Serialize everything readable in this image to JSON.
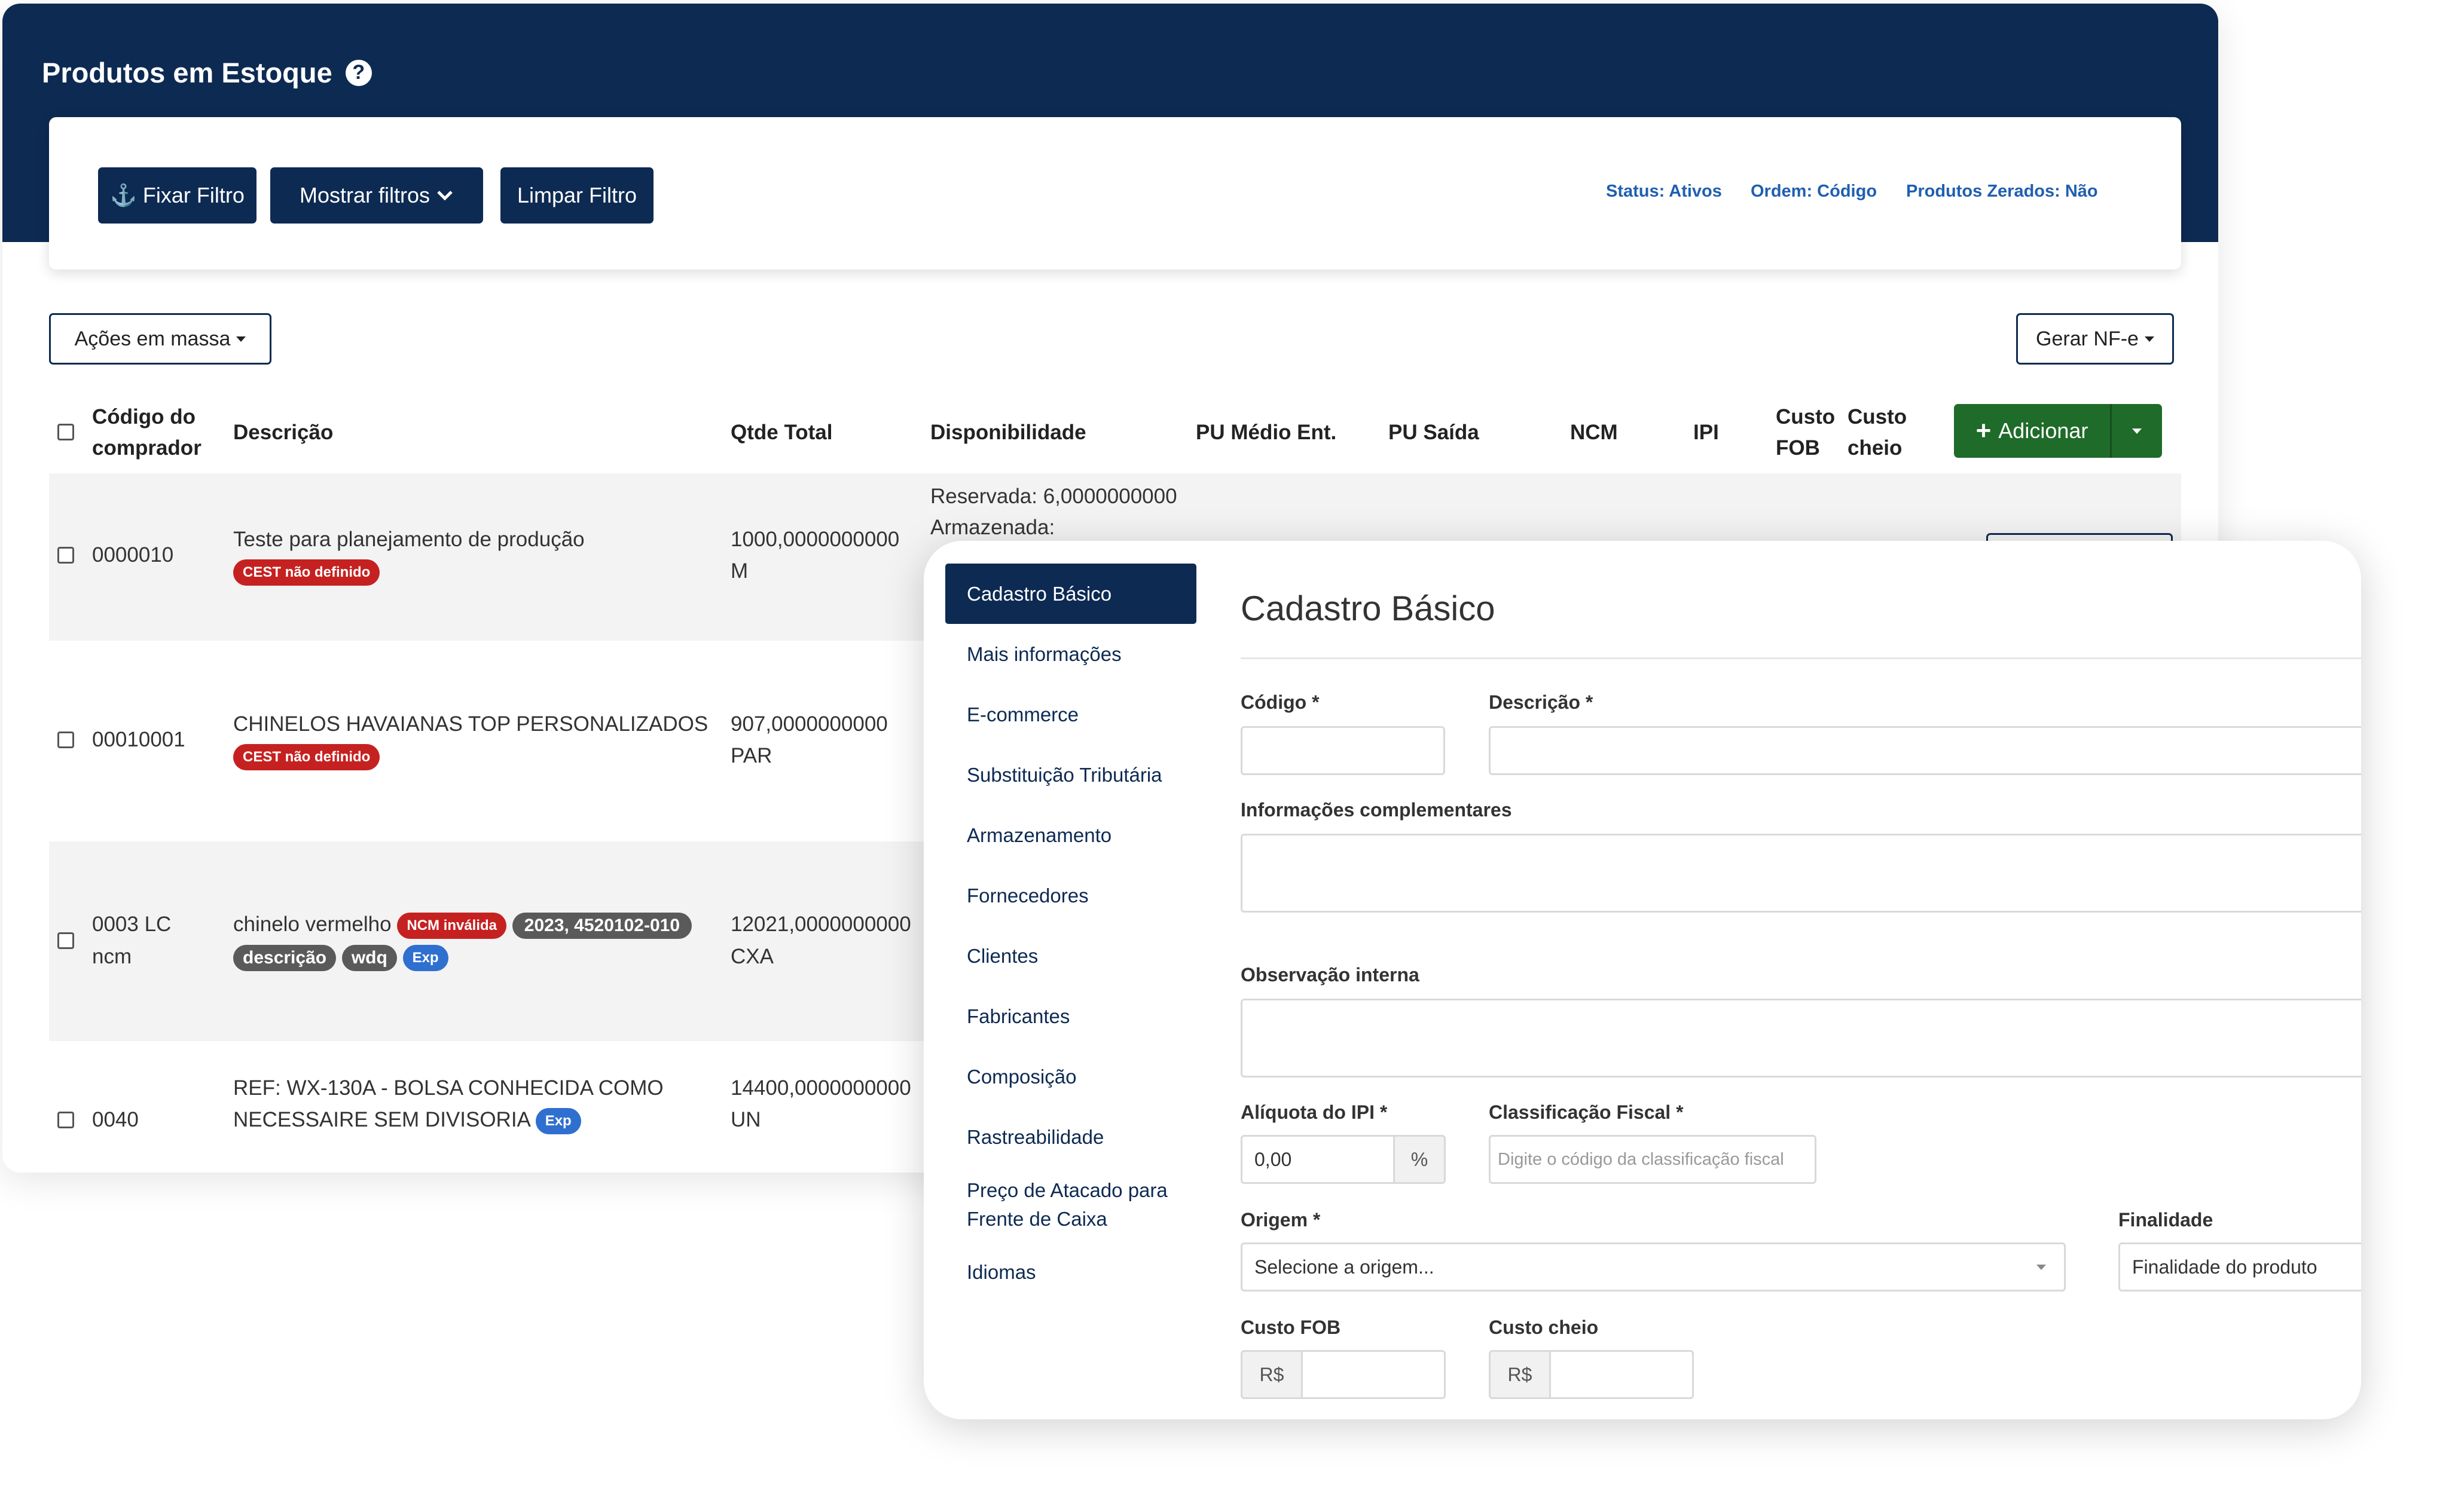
{
  "header": {
    "title": "Produtos em Estoque",
    "help_icon": "question-circle-icon"
  },
  "filters": {
    "fix_filter": "Fixar Filtro",
    "show_filters": "Mostrar filtros",
    "clear_filter": "Limpar Filtro",
    "status": "Status: Ativos",
    "order": "Ordem: Código",
    "zeroed": "Produtos Zerados: Não"
  },
  "toolbar": {
    "bulk_actions": "Ações em massa",
    "generate_nfe": "Gerar NF-e",
    "add": "Adicionar"
  },
  "table": {
    "col_code_1": "Código do",
    "col_code_2": "comprador",
    "col_desc": "Descrição",
    "col_qty": "Qtde Total",
    "col_avail": "Disponibilidade",
    "col_pu_in": "PU Médio Ent.",
    "col_pu_out": "PU Saída",
    "col_ncm": "NCM",
    "col_ipi": "IPI",
    "col_fob_1": "Custo",
    "col_fob_2": "FOB",
    "col_full_1": "Custo",
    "col_full_2": "cheio",
    "rows": [
      {
        "code": "0000010",
        "desc": "Teste para planejamento de produção",
        "badge1": "CEST não definido",
        "qty": "1000,0000000000",
        "unit": "M",
        "avail1": "Reservada: 6,0000000000",
        "avail2": "Armazenada:"
      },
      {
        "code": "00010001",
        "desc": "CHINELOS HAVAIANAS TOP PERSONALIZADOS",
        "badge1": "CEST não definido",
        "qty": "907,0000000000",
        "unit": "PAR"
      },
      {
        "code1": "0003 LC",
        "code2": "ncm",
        "desc": "chinelo vermelho",
        "badge_ncm": "NCM inválida",
        "badge_tag1": "2023, 4520102-010",
        "badge_tag2": "descrição",
        "badge_tag3": "wdq",
        "badge_exp": "Exp",
        "qty": "12021,0000000000",
        "unit": "CXA"
      },
      {
        "code": "0040",
        "desc1": "REF: WX-130A - BOLSA CONHECIDA COMO",
        "desc2": "NECESSAIRE SEM DIVISORIA",
        "badge_exp": "Exp",
        "qty": "14400,0000000000",
        "unit": "UN"
      }
    ]
  },
  "modal": {
    "nav": [
      "Cadastro Básico",
      "Mais informações",
      "E-commerce",
      "Substituição Tributária",
      "Armazenamento",
      "Fornecedores",
      "Clientes",
      "Fabricantes",
      "Composição",
      "Rastreabilidade",
      "Preço de Atacado para",
      "Frente de Caixa",
      "Idiomas"
    ],
    "title": "Cadastro Básico",
    "codigo_label": "Código *",
    "descricao_label": "Descrição *",
    "info_label": "Informações complementares",
    "obs_label": "Observação interna",
    "ipi_label": "Alíquota do IPI *",
    "ipi_value": "0,00",
    "ipi_unit": "%",
    "class_label": "Classificação Fiscal *",
    "class_placeholder": "Digite o código da classificação fiscal",
    "origem_label": "Origem *",
    "origem_value": "Selecione a origem...",
    "finalidade_label": "Finalidade",
    "finalidade_value": "Finalidade do produto",
    "fob_label": "Custo FOB",
    "cheio_label": "Custo cheio",
    "currency": "R$"
  }
}
